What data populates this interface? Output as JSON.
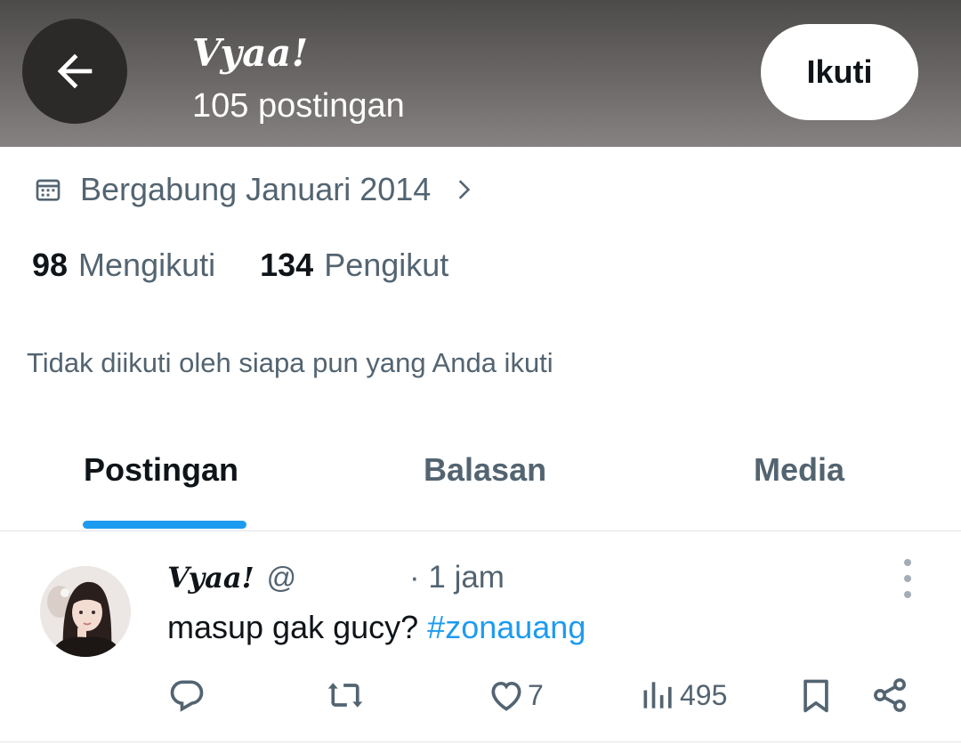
{
  "header": {
    "title": "Vyaa!",
    "subtitle": "105 postingan",
    "follow_label": "Ikuti"
  },
  "profile": {
    "joined": "Bergabung Januari 2014",
    "following_count": "98",
    "following_label": "Mengikuti",
    "followers_count": "134",
    "followers_label": "Pengikut",
    "not_followed_text": "Tidak diikuti oleh siapa pun yang Anda ikuti"
  },
  "tabs": [
    {
      "label": "Postingan",
      "active": true
    },
    {
      "label": "Balasan",
      "active": false
    },
    {
      "label": "Media",
      "active": false
    }
  ],
  "post": {
    "name": "Vyaa!",
    "handle": "@",
    "time": "· 1 jam",
    "text": "masup gak gucy? ",
    "hashtag": "#zonauang",
    "likes": "7",
    "views": "495"
  },
  "colors": {
    "accent": "#1d9bf0",
    "muted": "#536471",
    "text": "#0f1419"
  },
  "icons": [
    "back-arrow-icon",
    "calendar-icon",
    "chevron-right-icon",
    "more-vertical-icon",
    "reply-icon",
    "repost-icon",
    "like-icon",
    "views-icon",
    "bookmark-icon",
    "share-icon"
  ]
}
